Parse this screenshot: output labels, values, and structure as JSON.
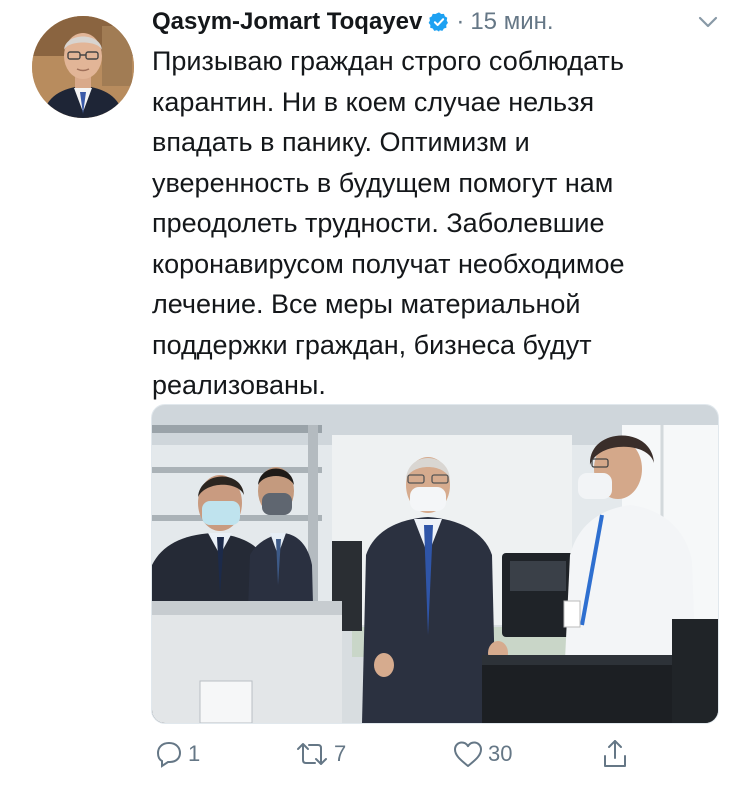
{
  "tweet": {
    "author_name": "Qasym-Jomart Toqayev",
    "separator": "·",
    "timestamp": "15 мин.",
    "text_lines": [
      "Призываю граждан строго соблюдать",
      "карантин. Ни в коем случае нельзя",
      "впадать в панику. Оптимизм и",
      "уверенность в будущем помогут нам",
      "преодолеть трудности. Заболевшие",
      "коронавирусом получат необходимое",
      "лечение. Все меры материальной",
      "поддержки граждан, бизнеса будут",
      "реализованы."
    ],
    "replies": "1",
    "retweets": "7",
    "likes": "30"
  },
  "icons": {
    "verified": "verified-badge-icon",
    "menu": "chevron-down-icon",
    "reply": "reply-icon",
    "retweet": "retweet-icon",
    "like": "heart-icon",
    "share": "share-icon"
  },
  "colors": {
    "verified_blue": "#1da1f2",
    "secondary_text": "#657786",
    "primary_text": "#14171a"
  }
}
